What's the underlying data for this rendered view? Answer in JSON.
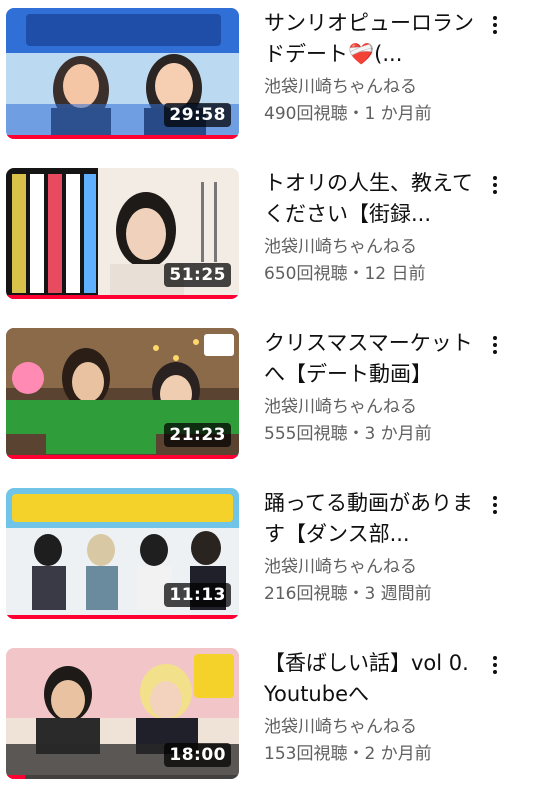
{
  "videos": [
    {
      "title": "サンリオピューロランドデート❤️‍🩹(...",
      "channel": "池袋川崎ちゃんねる",
      "stats": "490回視聴・1 か月前",
      "duration": "29:58",
      "progress_percent": 100,
      "thumbnail_icon": "puroland-date-thumbnail",
      "thumbnail_colors": [
        "#2f6fd6",
        "#f4c6a6",
        "#ffffff"
      ]
    },
    {
      "title": "トオリの人生、教えてください【街録...",
      "channel": "池袋川崎ちゃんねる",
      "stats": "650回視聴・12 日前",
      "duration": "51:25",
      "progress_percent": 100,
      "thumbnail_icon": "interview-thumbnail",
      "thumbnail_colors": [
        "#1a1a1a",
        "#f0e8de",
        "#ffffff"
      ]
    },
    {
      "title": "クリスマスマーケットへ【デート動画】",
      "channel": "池袋川崎ちゃんねる",
      "stats": "555回視聴・3 か月前",
      "duration": "21:23",
      "progress_percent": 100,
      "thumbnail_icon": "xmas-market-thumbnail",
      "thumbnail_colors": [
        "#3a2a1c",
        "#c9a064",
        "#2f9e3a"
      ]
    },
    {
      "title": "踊ってる動画があります【ダンス部...",
      "channel": "池袋川崎ちゃんねる",
      "stats": "216回視聴・3 週間前",
      "duration": "11:13",
      "progress_percent": 100,
      "thumbnail_icon": "dance-club-thumbnail",
      "thumbnail_colors": [
        "#6fc4e8",
        "#f4d22a",
        "#e9ecf0"
      ]
    },
    {
      "title": "【香ばしい話】vol 0. Youtubeへ",
      "channel": "池袋川崎ちゃんねる",
      "stats": "153回視聴・2 か月前",
      "duration": "18:00",
      "progress_percent": 8,
      "thumbnail_icon": "kobashii-talk-thumbnail",
      "thumbnail_colors": [
        "#f2c6c8",
        "#efe3d8",
        "#2a2a2a"
      ]
    }
  ],
  "accent_color": "#ff0033"
}
